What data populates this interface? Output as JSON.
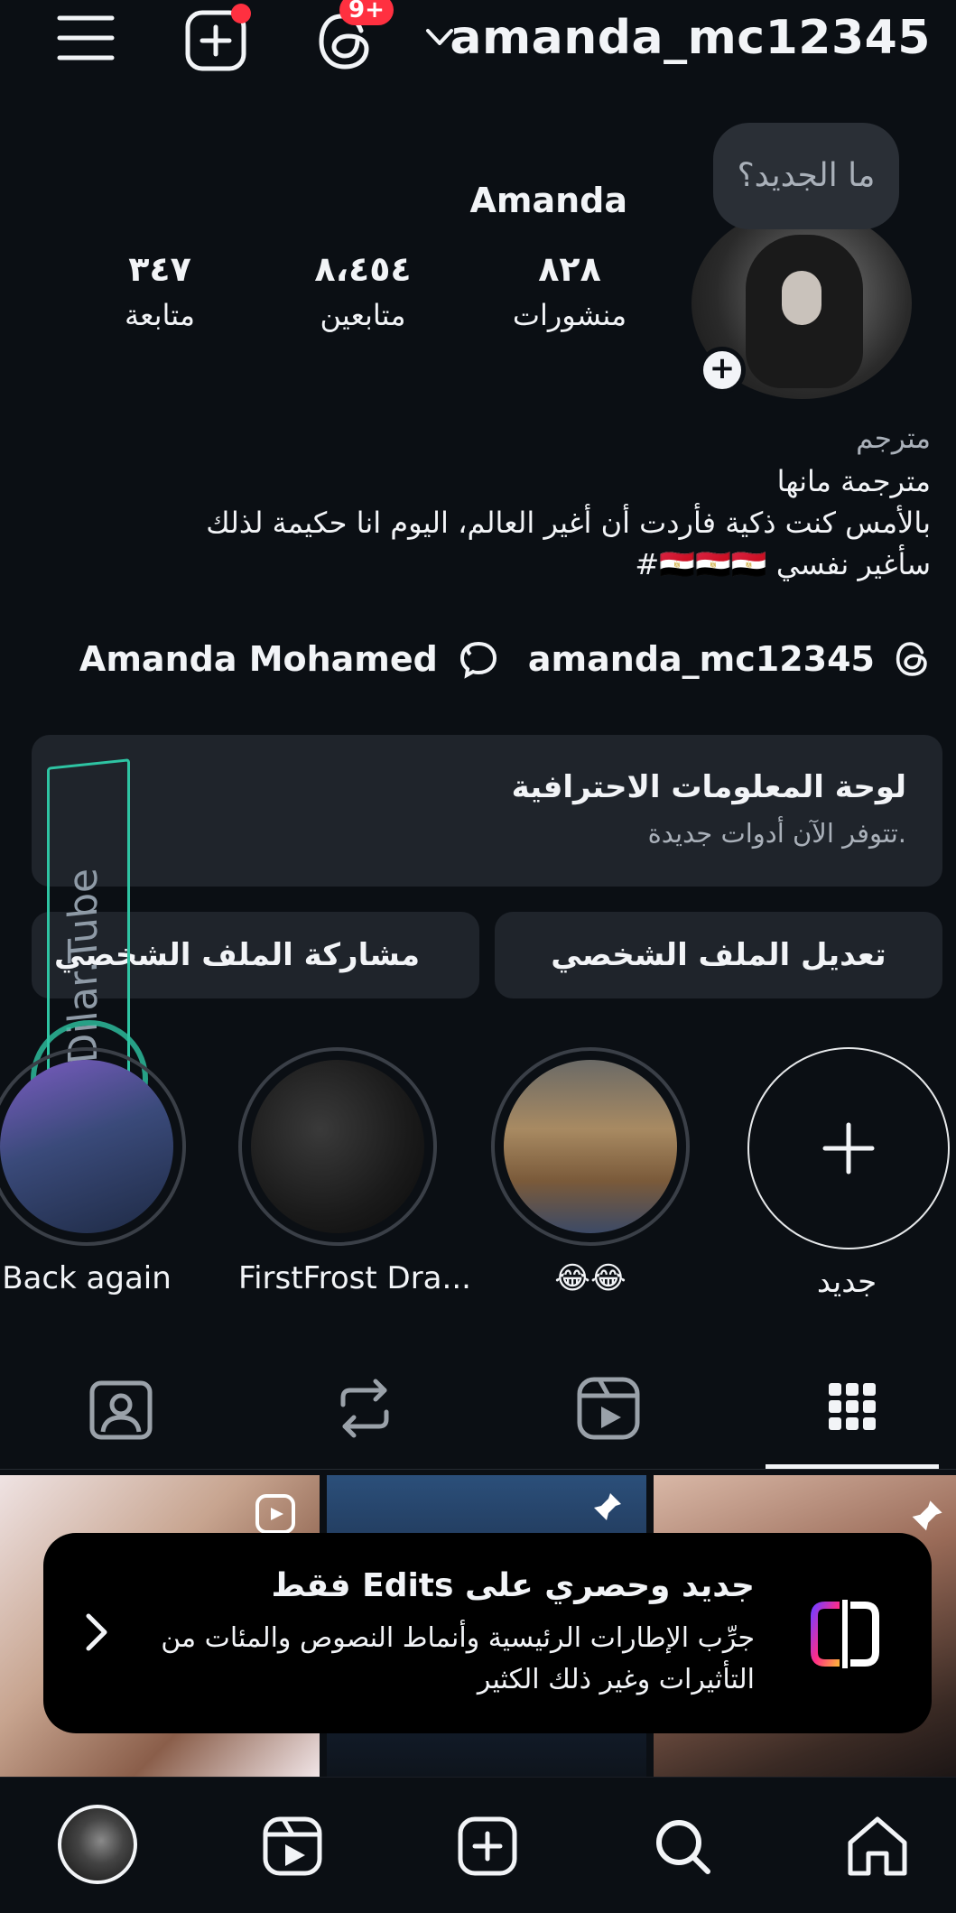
{
  "topbar": {
    "username": "amanda_mc12345",
    "threads_badge": "9+"
  },
  "profile": {
    "display_name": "Amanda",
    "note_placeholder": "ما الجديد؟",
    "stats": [
      {
        "value": "٨٢٨",
        "label": "منشورات"
      },
      {
        "value": "٨،٤٥٤",
        "label": "متابعين"
      },
      {
        "value": "٣٤٧",
        "label": "متابعة"
      }
    ],
    "category": "مترجم",
    "bio_lines": [
      "مترجمة مانها",
      "بالأمس كنت ذكية فأردت أن أغير العالم، اليوم انا حكيمة لذلك",
      "سأغير نفسي 🇪🇬🇪🇬🇪🇬#"
    ],
    "threads_link": "amanda_mc12345",
    "linked_name": "Amanda Mohamed"
  },
  "professional_dashboard": {
    "title": "لوحة المعلومات الاحترافية",
    "subtitle": "تتوفر الآن أدوات جديدة."
  },
  "buttons": {
    "edit_profile": "تعديل الملف الشخصي",
    "share_profile": "مشاركة الملف الشخصي"
  },
  "highlights": [
    {
      "label": "جديد"
    },
    {
      "label": "😂😂"
    },
    {
      "label": "FirstFrost Dra..."
    },
    {
      "label": "Back again"
    }
  ],
  "promo": {
    "title": "جديد وحصري على Edits فقط",
    "body": "جرِّب الإطارات الرئيسية وأنماط النصوص والمئات من التأثيرات وغير ذلك الكثير"
  },
  "watermark": "Dilar.Tube",
  "colors": {
    "background": "#0b0f14",
    "card": "#1f242b",
    "notification": "#ff3040",
    "text": "#f2f4f7",
    "muted": "#a9b0b9"
  }
}
